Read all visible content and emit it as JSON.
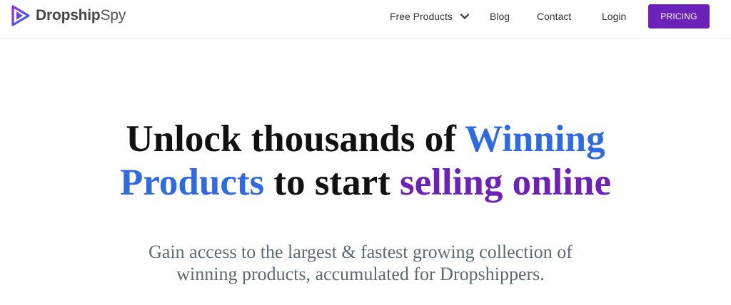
{
  "brand": {
    "name_part1": "Dropship",
    "name_part2": "Spy",
    "logo_icon": "play-triangle-icon",
    "colors": {
      "logo_start": "#8a2be2",
      "logo_end": "#3b6cf0"
    }
  },
  "nav": {
    "items": [
      {
        "label": "Free Products",
        "has_dropdown": true
      },
      {
        "label": "Blog"
      },
      {
        "label": "Contact"
      },
      {
        "label": "Login"
      }
    ],
    "cta_label": "PRICING",
    "dropdown_icon": "chevron-down-icon"
  },
  "hero": {
    "title_part1": "Unlock thousands of ",
    "title_highlight1": "Winning",
    "title_highlight2": "Products",
    "title_part2": " to start ",
    "title_highlight3": "selling online",
    "subtitle_line1": "Gain access to the largest & fastest growing collection of",
    "subtitle_line2": "winning products, accumulated for Dropshippers."
  },
  "colors": {
    "accent_purple": "#6c22b8",
    "accent_blue": "#2d6ae3",
    "heading": "#111111",
    "subtext": "#5a6a78"
  }
}
